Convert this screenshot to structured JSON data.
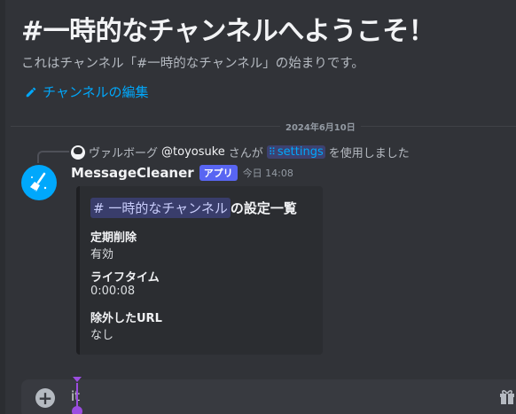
{
  "welcome": {
    "title": "#一時的なチャンネルへようこそ！",
    "subtitle": "これはチャンネル「#一時的なチャンネル」の始まりです。",
    "edit_label": "チャンネルの編集"
  },
  "divider": {
    "date": "2024年6月10日"
  },
  "reply": {
    "name": "ヴァルボーグ",
    "handle": "@toyosuke",
    "middle": "さんが",
    "command": "settings",
    "suffix": "を使用しました"
  },
  "message": {
    "username": "MessageCleaner",
    "tag": "アプリ",
    "timestamp": "今日 14:08",
    "embed": {
      "channel": "# 一時的なチャンネル",
      "title_suffix": "の設定一覧",
      "fields": [
        {
          "name": "定期削除",
          "value": "有効"
        },
        {
          "name": "ライフタイム",
          "value": "0:00:08"
        },
        {
          "name": "除外したURL",
          "value": "なし"
        }
      ]
    }
  },
  "composer": {
    "value": "it"
  },
  "colors": {
    "accent": "#5865f2",
    "link": "#00a8fc",
    "background": "#313338"
  }
}
